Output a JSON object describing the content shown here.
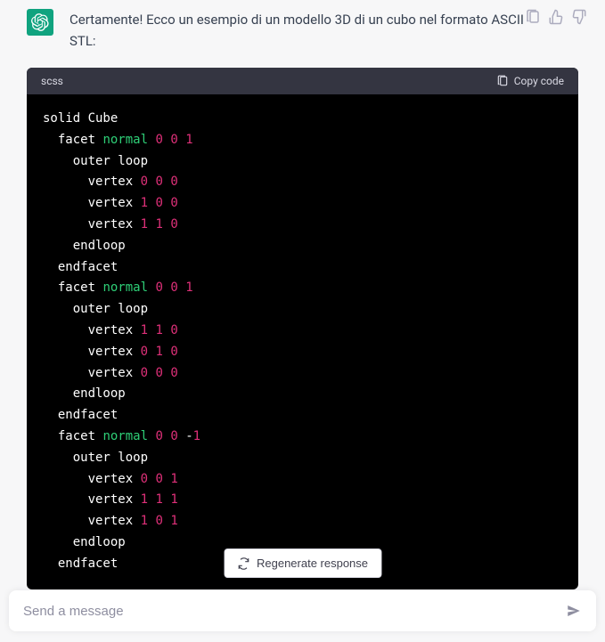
{
  "message": {
    "intro": "Certamente! Ecco un esempio di un modello 3D di un cubo nel formato ASCII STL:"
  },
  "code": {
    "language": "scss",
    "copy_label": "Copy code",
    "lines": [
      [
        {
          "t": "solid Cube",
          "c": "kw"
        }
      ],
      [
        {
          "t": "  facet ",
          "c": "kw"
        },
        {
          "t": "normal",
          "c": "fn"
        },
        {
          "t": " ",
          "c": "kw"
        },
        {
          "t": "0",
          "c": "num"
        },
        {
          "t": " ",
          "c": "kw"
        },
        {
          "t": "0",
          "c": "num"
        },
        {
          "t": " ",
          "c": "kw"
        },
        {
          "t": "1",
          "c": "num"
        }
      ],
      [
        {
          "t": "    outer loop",
          "c": "kw"
        }
      ],
      [
        {
          "t": "      vertex ",
          "c": "kw"
        },
        {
          "t": "0",
          "c": "num"
        },
        {
          "t": " ",
          "c": "kw"
        },
        {
          "t": "0",
          "c": "num"
        },
        {
          "t": " ",
          "c": "kw"
        },
        {
          "t": "0",
          "c": "num"
        }
      ],
      [
        {
          "t": "      vertex ",
          "c": "kw"
        },
        {
          "t": "1",
          "c": "num"
        },
        {
          "t": " ",
          "c": "kw"
        },
        {
          "t": "0",
          "c": "num"
        },
        {
          "t": " ",
          "c": "kw"
        },
        {
          "t": "0",
          "c": "num"
        }
      ],
      [
        {
          "t": "      vertex ",
          "c": "kw"
        },
        {
          "t": "1",
          "c": "num"
        },
        {
          "t": " ",
          "c": "kw"
        },
        {
          "t": "1",
          "c": "num"
        },
        {
          "t": " ",
          "c": "kw"
        },
        {
          "t": "0",
          "c": "num"
        }
      ],
      [
        {
          "t": "    endloop",
          "c": "kw"
        }
      ],
      [
        {
          "t": "  endfacet",
          "c": "kw"
        }
      ],
      [
        {
          "t": "  facet ",
          "c": "kw"
        },
        {
          "t": "normal",
          "c": "fn"
        },
        {
          "t": " ",
          "c": "kw"
        },
        {
          "t": "0",
          "c": "num"
        },
        {
          "t": " ",
          "c": "kw"
        },
        {
          "t": "0",
          "c": "num"
        },
        {
          "t": " ",
          "c": "kw"
        },
        {
          "t": "1",
          "c": "num"
        }
      ],
      [
        {
          "t": "    outer loop",
          "c": "kw"
        }
      ],
      [
        {
          "t": "      vertex ",
          "c": "kw"
        },
        {
          "t": "1",
          "c": "num"
        },
        {
          "t": " ",
          "c": "kw"
        },
        {
          "t": "1",
          "c": "num"
        },
        {
          "t": " ",
          "c": "kw"
        },
        {
          "t": "0",
          "c": "num"
        }
      ],
      [
        {
          "t": "      vertex ",
          "c": "kw"
        },
        {
          "t": "0",
          "c": "num"
        },
        {
          "t": " ",
          "c": "kw"
        },
        {
          "t": "1",
          "c": "num"
        },
        {
          "t": " ",
          "c": "kw"
        },
        {
          "t": "0",
          "c": "num"
        }
      ],
      [
        {
          "t": "      vertex ",
          "c": "kw"
        },
        {
          "t": "0",
          "c": "num"
        },
        {
          "t": " ",
          "c": "kw"
        },
        {
          "t": "0",
          "c": "num"
        },
        {
          "t": " ",
          "c": "kw"
        },
        {
          "t": "0",
          "c": "num"
        }
      ],
      [
        {
          "t": "    endloop",
          "c": "kw"
        }
      ],
      [
        {
          "t": "  endfacet",
          "c": "kw"
        }
      ],
      [
        {
          "t": "  facet ",
          "c": "kw"
        },
        {
          "t": "normal",
          "c": "fn"
        },
        {
          "t": " ",
          "c": "kw"
        },
        {
          "t": "0",
          "c": "num"
        },
        {
          "t": " ",
          "c": "kw"
        },
        {
          "t": "0",
          "c": "num"
        },
        {
          "t": " -",
          "c": "kw"
        },
        {
          "t": "1",
          "c": "num"
        }
      ],
      [
        {
          "t": "    outer loop",
          "c": "kw"
        }
      ],
      [
        {
          "t": "      vertex ",
          "c": "kw"
        },
        {
          "t": "0",
          "c": "num"
        },
        {
          "t": " ",
          "c": "kw"
        },
        {
          "t": "0",
          "c": "num"
        },
        {
          "t": " ",
          "c": "kw"
        },
        {
          "t": "1",
          "c": "num"
        }
      ],
      [
        {
          "t": "      vertex ",
          "c": "kw"
        },
        {
          "t": "1",
          "c": "num"
        },
        {
          "t": " ",
          "c": "kw"
        },
        {
          "t": "1",
          "c": "num"
        },
        {
          "t": " ",
          "c": "kw"
        },
        {
          "t": "1",
          "c": "num"
        }
      ],
      [
        {
          "t": "      vertex ",
          "c": "kw"
        },
        {
          "t": "1",
          "c": "num"
        },
        {
          "t": " ",
          "c": "kw"
        },
        {
          "t": "0",
          "c": "num"
        },
        {
          "t": " ",
          "c": "kw"
        },
        {
          "t": "1",
          "c": "num"
        }
      ],
      [
        {
          "t": "    endloop",
          "c": "kw"
        }
      ],
      [
        {
          "t": "  endfacet",
          "c": "kw"
        }
      ]
    ]
  },
  "controls": {
    "regenerate": "Regenerate response"
  },
  "input": {
    "placeholder": "Send a message"
  }
}
